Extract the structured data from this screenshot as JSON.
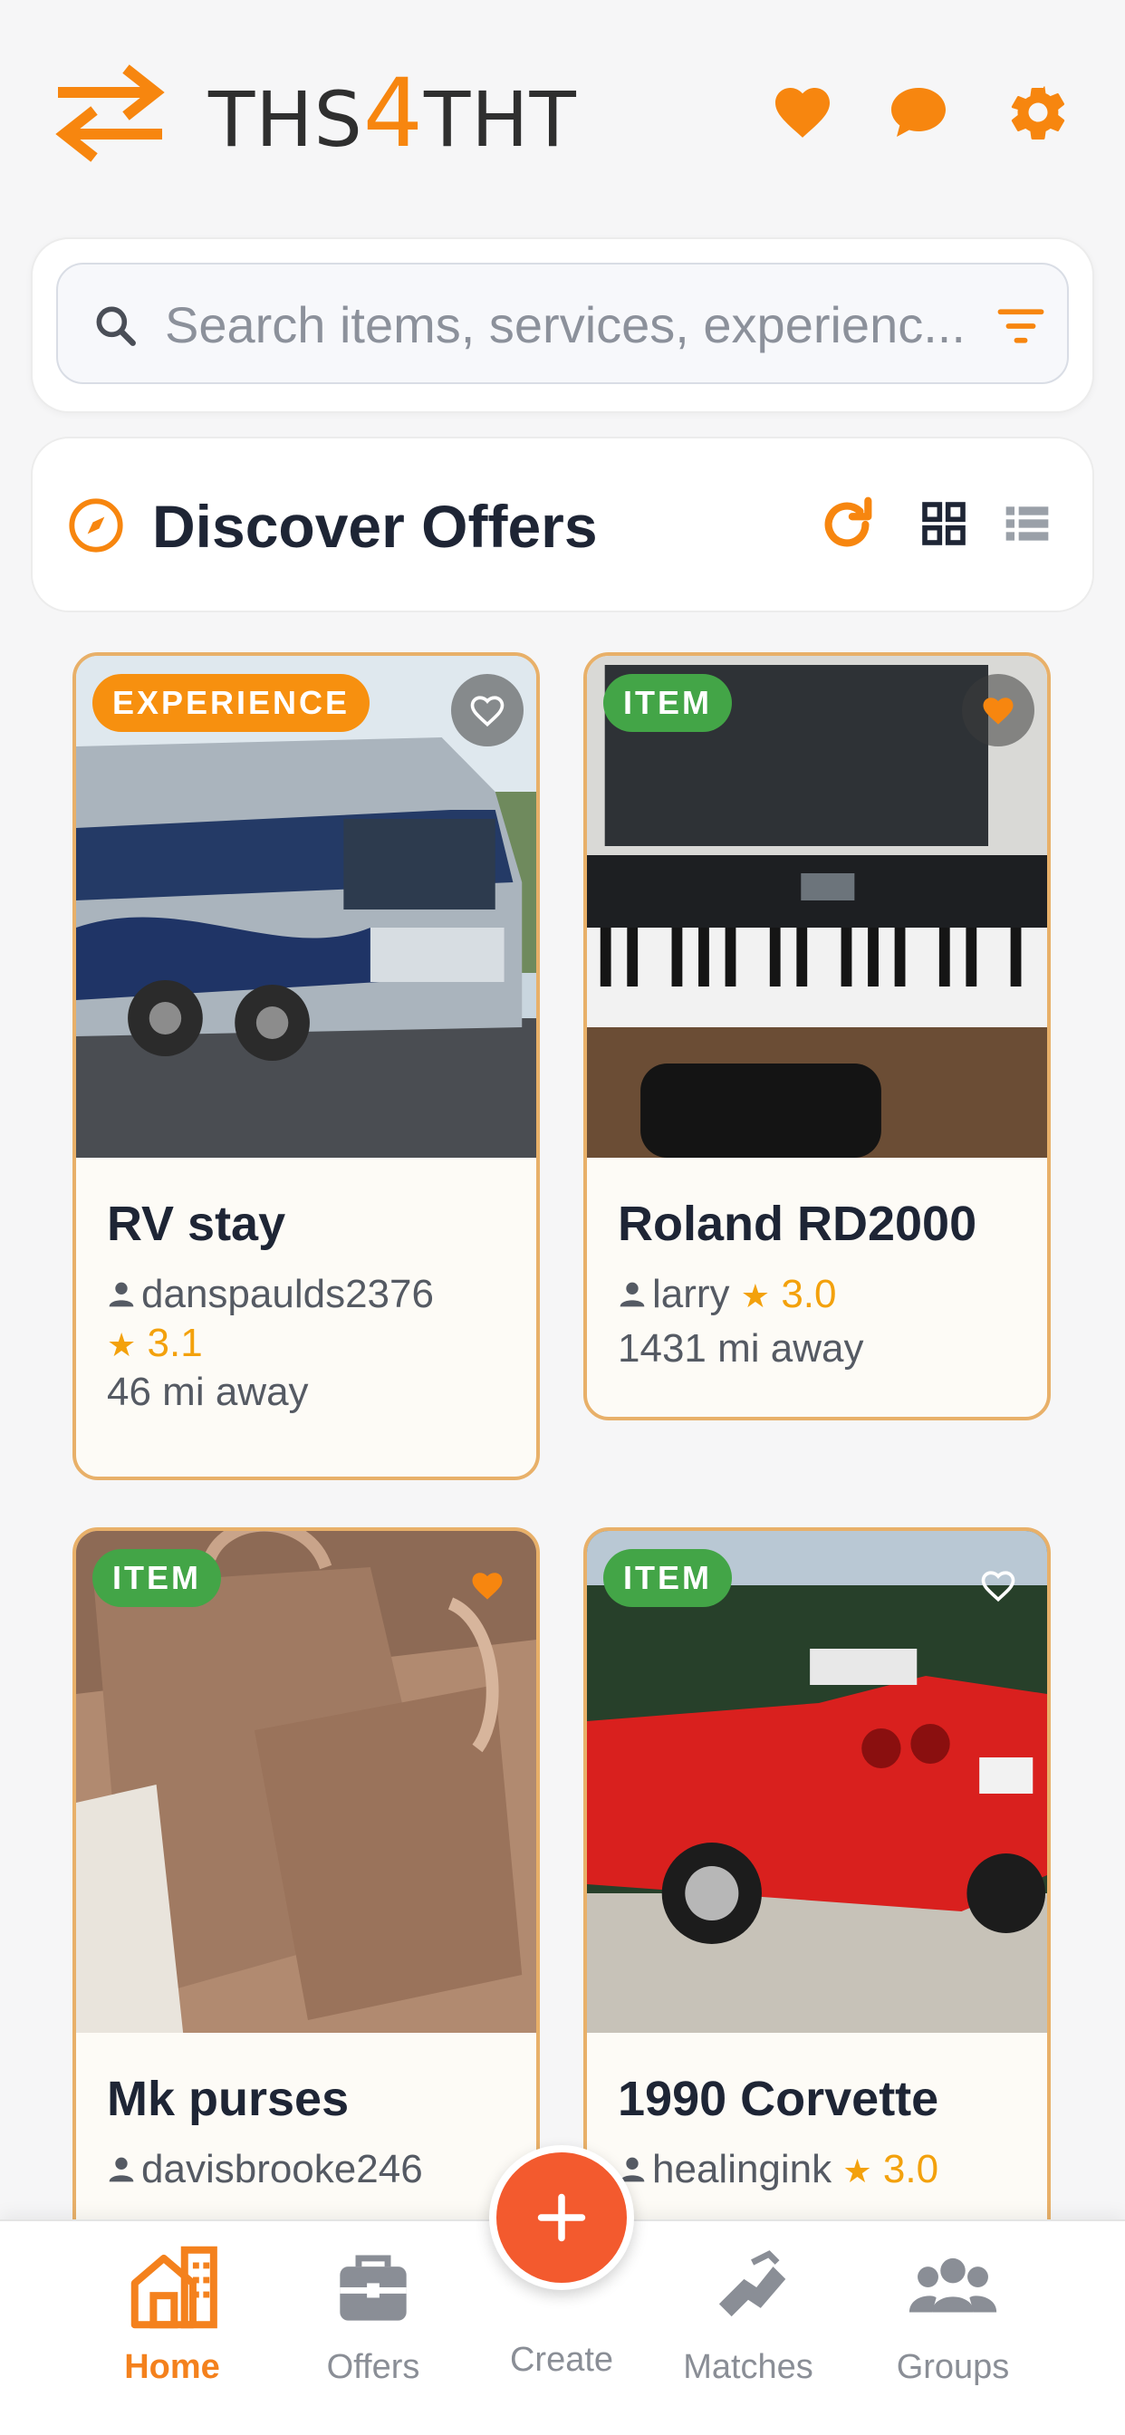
{
  "header": {
    "logo_prefix": "THS",
    "logo_number": "4",
    "logo_suffix": "THT",
    "icons": [
      "heart-icon",
      "chat-icon",
      "gear-icon"
    ]
  },
  "search": {
    "placeholder": "Search items, services, experienc..."
  },
  "discover": {
    "title": "Discover Offers"
  },
  "offers": [
    {
      "badge": "EXPERIENCE",
      "title": "RV stay",
      "user": "danspaulds2376",
      "rating": "3.1",
      "distance": "46 mi away",
      "favorited": false
    },
    {
      "badge": "ITEM",
      "title": "Roland RD2000",
      "user": "larry",
      "rating": "3.0",
      "distance": "1431 mi away",
      "favorited": true
    },
    {
      "badge": "ITEM",
      "title": "Mk purses",
      "user": "davisbrooke246",
      "favorited": true
    },
    {
      "badge": "ITEM",
      "title": "1990 Corvette",
      "user": "healingink",
      "rating": "3.0",
      "favorited": false
    }
  ],
  "nav": {
    "home": "Home",
    "offers": "Offers",
    "create": "Create",
    "matches": "Matches",
    "groups": "Groups"
  },
  "colors": {
    "accent": "#f7860f",
    "badge_experience": "#f7900f",
    "badge_item": "#43a547",
    "create_button": "#f35a2e",
    "rating": "#f3a10c"
  }
}
